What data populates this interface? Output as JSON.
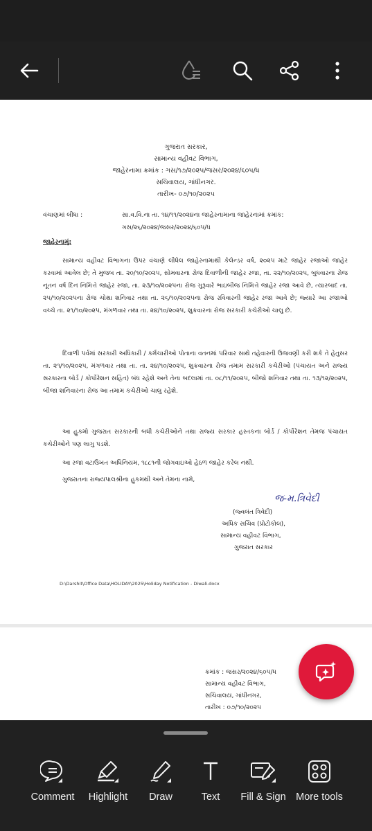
{
  "toolbar": {
    "back_icon": "arrow-left-icon",
    "icons": [
      "liquid-mode-icon",
      "search-icon",
      "share-icon",
      "more-vertical-icon"
    ]
  },
  "document": {
    "header_lines": [
      "ગુજરાત સરકાર,",
      "સામાન્ય વહીવટ વિભાગ,",
      "જાહેરનામા ક્રમાંક : ગસ/૧૭/૨૦૨૫/જસર/૨૦૨૪/૬૦૫/ધ",
      "સચિવાલય, ગાંધીનગર.",
      "તારીખ- ૦૭/૧૦/૨૦૨૫"
    ],
    "reference_label": "વંચાણમાં લીધા :",
    "reference_line1": "સા.વ.વિ.ના તા. ૧૪/૧૧/૨૦૨૪ના જાહેરનામાના જાહેરનામાં ક્રમાંક:",
    "reference_line2": "ગસ/૨૬/૨૦૨૪/જસર/૨૦૨૪/૬૦૫/ધ",
    "notice_heading": "જાહેરનામું:",
    "para1": "સામાન્ય વહીવટ વિભાગના ઉપર વંચાણે લીધેલ જાહેરનામાથી કેલેન્ડર વર્ષ, ૨૦૨૫ માટે જાહેર રજાઓ જાહેર કરવામાં આવેલ છે; તે મુજબ તા. ૨૦/૧૦/૨૦૨૫, સોમવારના રોજ દિવાળીની જાહેર રજા, તા. ૨૨/૧૦/૨૦૨૫, બુધવારના રોજ નૂતન વર્ષ દિન નિમિત્તે જાહેર રજા, તા. ૨૩/૧૦/૨૦૨૫ના રોજ ગુરૂવારે ભાઇબીજ નિમિત્તે જાહેર રજા આવે છે, ત્યારબાદ તા. ૨૫/૧૦/૨૦૨૫ના રોજ ચોથા શનિવાર તથા તા. ૨૬/૧૦/૨૦૨૫ના રોજ રવિવારની જાહેર રજા આવે છે; જ્યારે આ રજાઓ વચ્ચે તા. ૨૧/૧૦/૨૦૨૫, મંગળવાર તથા તા. ૨૪/૧૦/૨૦૨૫, શુક્રવારના રોજ સરકારી કચેરીઓ ચાલુ છે.",
    "para2": "દિવાળી પર્વમાં સરકારી અધિકારી / કર્મચારીઓ પોતાના વતનમાં પરિવાર સાથે તહેવારની ઉજવણી કરી શકે તે હેતુસર તા. ૨૧/૧૦/૨૦૨૫, મંગળવાર તથા તા. તા. ૨૪/૧૦/૨૦૨૫, શુક્રવારના રોજ તમામ સરકારી કચેરીઓ (પંચાયત અને રાજ્ય સરકારના બોર્ડ / કોર્પોરેશન સહિત) બંધ રહેશે અને તેના બદલામાં તા. ૦૮/૧૧/૨૦૨૫, બીજો શનિવાર તથા તા. ૧૩/૧૨/૨૦૨૫, બીજા શનિવારના રોજ આ તમામ કચેરીઓ ચાલુ રહેશે.",
    "para3": "આ હુકમો ગુજરાત સરકારની બધી કચેરીઓને તથા રાજ્ય સરકાર હસ્તકના બોર્ડ / કોર્પોરેશન તેમજ પંચાયત કચેરીઓને પણ લાગુ પડશે.",
    "para4": "આ રજા વટાઉખત અધિનિયમ, ૧૮૮૧ની જોગવાઇઓ હેઠળ જાહેર કરેલ નથી.",
    "para5": "ગુજરાતના રાજ્યપાલશ્રીના હુકમથી અને તેમના નામે,",
    "signature": "જ-મ.ત્રિવેદી",
    "signatory_lines": [
      "(જ્વલંત ત્રિવેદી)",
      "અધિક સચિવ (પ્રોટોકોલ),",
      "સામાન્ય વહીવટ વિભાગ,",
      "ગુજરાત સરકાર"
    ],
    "file_path": "D:\\Darshit\\Office Data\\HOLIDAY\\2025\\Holiday Notification - Diwali.docx",
    "page2_lines": [
      "ક્રમાંક : જસર/૨૦૨૪/૬૦૫/ધ",
      "સામાન્ય વહીવટ વિભાગ,",
      "સચિવાલય, ગાંધીનગર,",
      "તારીખ : ૦૭/૧૦/૨૦૨૫"
    ]
  },
  "fab": {
    "icon": "ai-assistant-icon",
    "color": "#e0193a"
  },
  "bottom_tools": [
    {
      "label": "Comment",
      "icon": "comment-icon"
    },
    {
      "label": "Highlight",
      "icon": "highlight-icon"
    },
    {
      "label": "Draw",
      "icon": "draw-icon"
    },
    {
      "label": "Text",
      "icon": "text-icon"
    },
    {
      "label": "Fill & Sign",
      "icon": "fill-sign-icon"
    },
    {
      "label": "More tools",
      "icon": "more-tools-icon"
    }
  ]
}
